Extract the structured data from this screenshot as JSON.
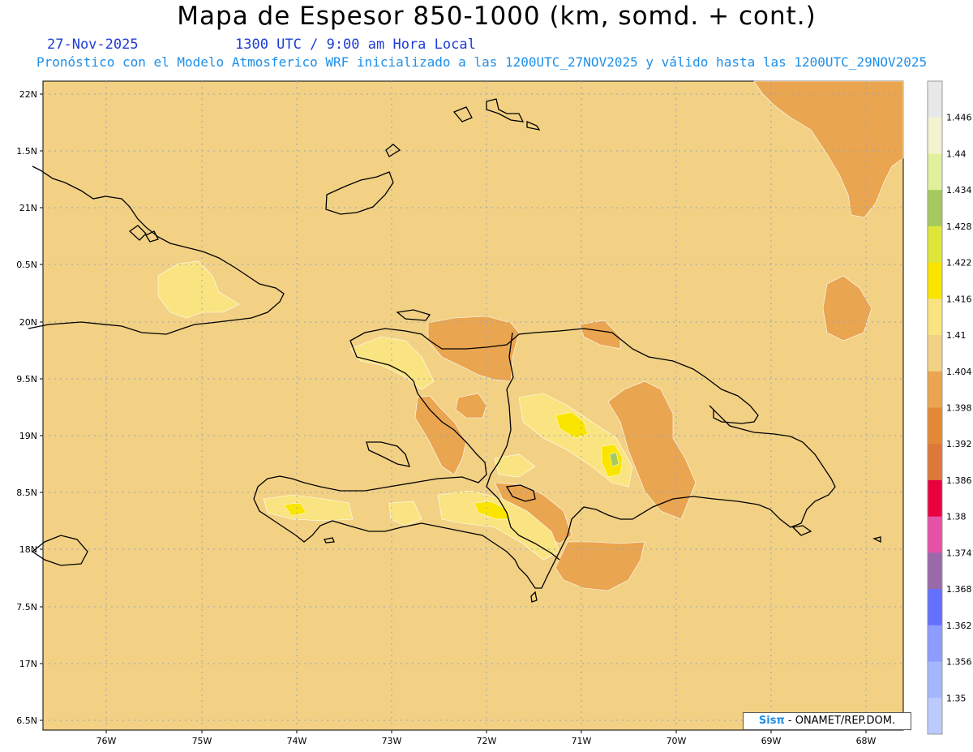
{
  "header": {
    "title": "Mapa de Espesor 850-1000 (km, somd. + cont.)",
    "date": "27-Nov-2025",
    "time": "1300 UTC / 9:00 am Hora Local",
    "subtitle": "Pronóstico con el Modelo Atmosferico WRF inicializado a las 1200UTC_27NOV2025 y válido hasta las  1200UTC_29NOV2025"
  },
  "map": {
    "lat_ticks": [
      "22N",
      "1.5N",
      "21N",
      "0.5N",
      "20N",
      "9.5N",
      "19N",
      "8.5N",
      "18N",
      "7.5N",
      "17N",
      "6.5N"
    ],
    "lon_ticks": [
      "76W",
      "75W",
      "74W",
      "73W",
      "72W",
      "71W",
      "70W",
      "69W",
      "68W"
    ],
    "background_color": "#f2d184",
    "coastline_color": "#000000",
    "grid_color": "#9aa3b8"
  },
  "colorbar": {
    "labels": [
      "1.446",
      "1.44",
      "1.434",
      "1.428",
      "1.422",
      "1.416",
      "1.41",
      "1.404",
      "1.398",
      "1.392",
      "1.386",
      "1.38",
      "1.374",
      "1.368",
      "1.362",
      "1.356",
      "1.35"
    ],
    "colors": [
      "#e8e8e8",
      "#f3f3d2",
      "#e1f09c",
      "#a6c95e",
      "#dfe63a",
      "#fae500",
      "#fae481",
      "#f2d184",
      "#eaa550",
      "#e48a37",
      "#dd7838",
      "#e8003f",
      "#e650a6",
      "#9a69aa",
      "#6470ff",
      "#8c9cff",
      "#a3b7ff",
      "#bccbff"
    ]
  },
  "credit": {
    "logo": "Sisπ",
    "text": " - ONAMET/REP.DOM."
  }
}
